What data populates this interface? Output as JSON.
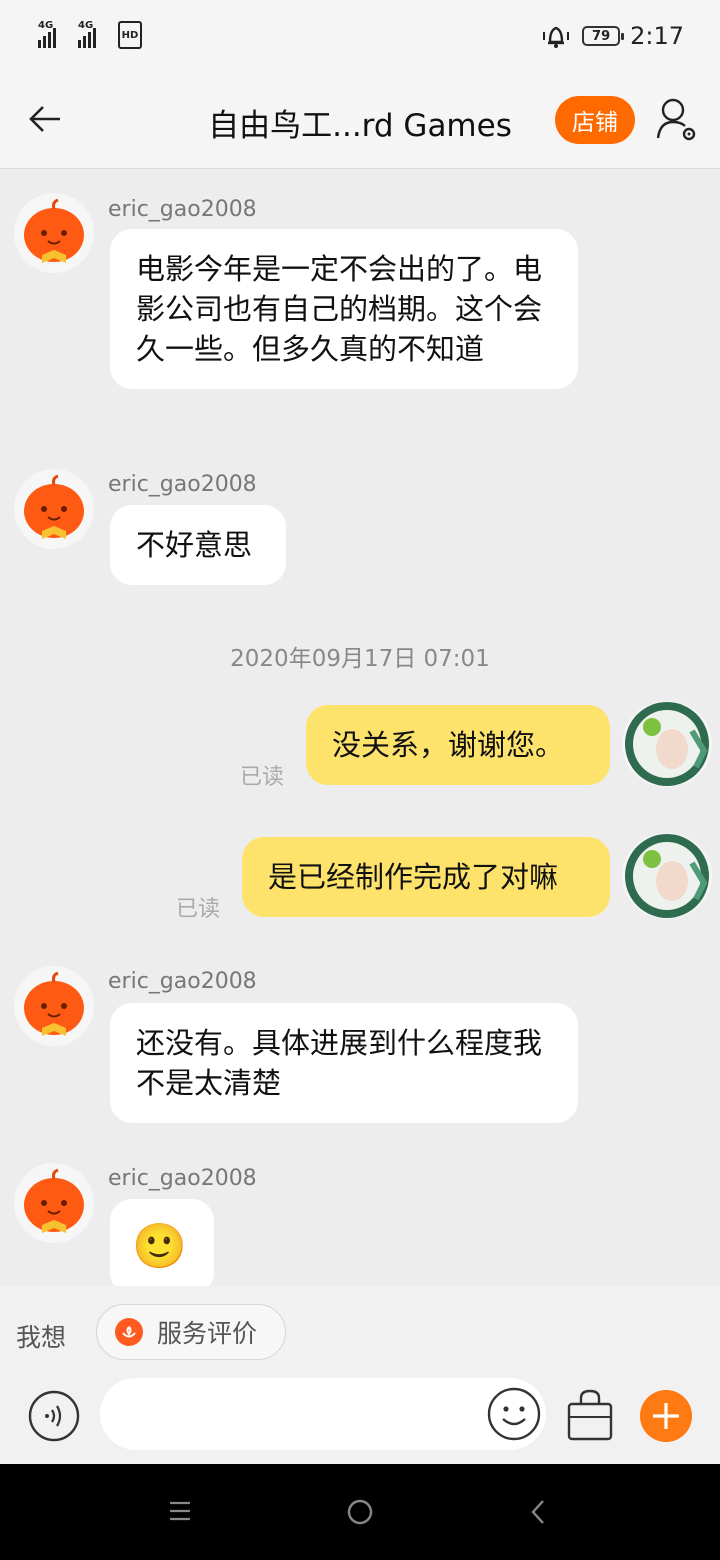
{
  "status_bar": {
    "net1": "4G",
    "net2": "4G",
    "hd": "HD",
    "battery": "79",
    "time": "2:17"
  },
  "header": {
    "title": "自由鸟工...rd Games",
    "shop_button": "店铺"
  },
  "messages": [
    {
      "sender": "eric_gao2008",
      "text": "电影今年是一定不会出的了。电影公司也有自己的档期。这个会久一些。但多久真的不知道"
    },
    {
      "sender": "eric_gao2008",
      "text": "不好意思"
    },
    {
      "timestamp": "2020年09月17日 07:01"
    },
    {
      "text": "没关系，谢谢您。",
      "read": "已读"
    },
    {
      "text": "是已经制作完成了对嘛",
      "read": "已读"
    },
    {
      "sender": "eric_gao2008",
      "text": "还没有。具体进展到什么程度我不是太清楚"
    },
    {
      "sender": "eric_gao2008",
      "emoji": "🙂"
    }
  ],
  "quick_bar": {
    "want": "我想",
    "service_rating": "服务评价"
  },
  "input": {
    "placeholder": ""
  },
  "colors": {
    "accent": "#ff6a00",
    "my_bubble": "#fde26c",
    "plus": "#ff7a12"
  },
  "icons": [
    "back-arrow-icon",
    "user-settings-icon",
    "voice-icon",
    "emoji-icon",
    "bag-icon",
    "plus-icon",
    "menu-icon",
    "home-icon",
    "back-nav-icon"
  ]
}
